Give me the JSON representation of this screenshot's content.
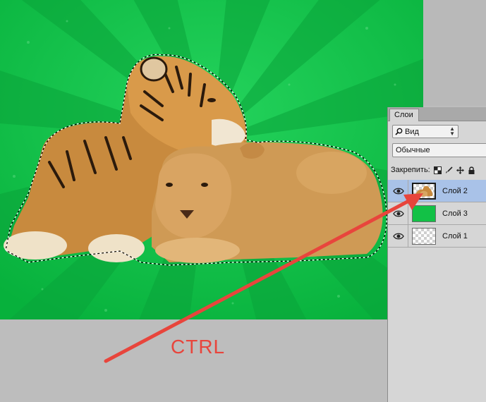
{
  "layers_panel": {
    "tab_label": "Слои",
    "filter": {
      "value": "Вид",
      "icon": "search-icon"
    },
    "blend_mode": "Обычные",
    "lock_label": "Закрепить:",
    "lock_icons": [
      "lock-transparent-icon",
      "lock-brush-icon",
      "lock-move-icon",
      "lock-all-icon"
    ],
    "layers": [
      {
        "name": "Слой 2",
        "thumb": "cutout",
        "selected": true
      },
      {
        "name": "Слой 3",
        "thumb": "green",
        "selected": false
      },
      {
        "name": "Слой 1",
        "thumb": "transparent",
        "selected": false
      }
    ]
  },
  "annotation": {
    "label": "CTRL",
    "color": "#e8453c"
  },
  "colors": {
    "canvas_green": "#0fc048",
    "selection_highlight": "#a9c2e8"
  }
}
